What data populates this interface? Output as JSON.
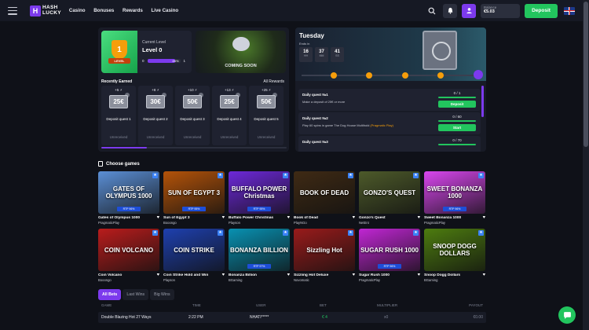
{
  "header": {
    "logo_mark": "H",
    "logo_line1": "HASH",
    "logo_line2": "LUCKY",
    "nav": [
      "Casino",
      "Bonuses",
      "Rewards",
      "Live Casino"
    ],
    "balance_label": "Balance",
    "balance_value": "€5.03",
    "deposit_label": "Deposit",
    "icons": [
      "menu-icon",
      "search-icon",
      "bell-icon",
      "user-icon",
      "uk-flag-icon"
    ]
  },
  "level": {
    "current_label": "Current Level",
    "name": "Level 0",
    "badge_number": "1",
    "badge_tag": "LEVEL",
    "from": "0",
    "to": "1",
    "progress_text": "85%",
    "progress": 0.85
  },
  "coming_soon": "COMING SOON",
  "rewards": {
    "recent_label": "Recently Earned",
    "all_label": "All Rewards",
    "items": [
      {
        "plus": "+5 ⚡",
        "amount": "25€",
        "name": "Deposit quest 1",
        "status": "Unreceived"
      },
      {
        "plus": "+8 ⚡",
        "amount": "30€",
        "name": "Deposit quest 2",
        "status": "Unreceived"
      },
      {
        "plus": "+10 ⚡",
        "amount": "50€",
        "name": "Deposit quest 3",
        "status": "Unreceived"
      },
      {
        "plus": "+13 ⚡",
        "amount": "25€",
        "name": "Deposit quest 4",
        "status": "Unreceived"
      },
      {
        "plus": "+25 ⚡",
        "amount": "50€",
        "name": "Deposit quest 5",
        "status": "Unreceived"
      }
    ]
  },
  "daily": {
    "day": "Tuesday",
    "ends_in": "Ends in",
    "timer": [
      {
        "n": "16",
        "u": "HH"
      },
      {
        "n": "37",
        "u": "MM"
      },
      {
        "n": "41",
        "u": "SS"
      }
    ],
    "quests": [
      {
        "title": "Daily quest №1",
        "desc": "Make a deposit of 25€ or more",
        "desc_highlight": "",
        "progress": "0 / 1",
        "button": "Deposit"
      },
      {
        "title": "Daily quest №2",
        "desc": "Play 60 spins in game The Dog House Multihold ",
        "desc_highlight": "(Pragmatic Play)",
        "progress": "0 / 60",
        "button": "Start"
      },
      {
        "title": "Daily quest №3",
        "desc": "",
        "desc_highlight": "",
        "progress": "0 / 70",
        "button": ""
      }
    ]
  },
  "games": {
    "title": "Choose games",
    "items": [
      {
        "name": "Gates of Olympus 1000",
        "provider": "PragmaticPlay",
        "art": "GATES OF OLYMPUS 1000",
        "bg": "#5b8fd6",
        "rtp": "RTP 96%"
      },
      {
        "name": "Sun of Egypt 3",
        "provider": "Booongo",
        "art": "SUN OF EGYPT 3",
        "bg": "#b45309",
        "rtp": "RTP 95%"
      },
      {
        "name": "Buffalo Power Christmas",
        "provider": "Playson",
        "art": "BUFFALO POWER Christmas",
        "bg": "#6d28d9",
        "rtp": "RTP 95%"
      },
      {
        "name": "Book of Dead",
        "provider": "PlayNGo",
        "art": "BOOK OF DEAD",
        "bg": "#3f2a14",
        "rtp": ""
      },
      {
        "name": "Gonzo's Quest",
        "provider": "NetEnt",
        "art": "GONZO'S QUEST",
        "bg": "#4d5a2a",
        "rtp": ""
      },
      {
        "name": "Sweet Bonanza 1000",
        "provider": "PragmaticPlay",
        "art": "SWEET BONANZA 1000",
        "bg": "#d946ef",
        "rtp": "RTP 96%"
      },
      {
        "name": "Coin Volcano",
        "provider": "Booongo",
        "art": "COIN VOLCANO",
        "bg": "#b91c1c",
        "rtp": ""
      },
      {
        "name": "Coin Strike Hold and Win",
        "provider": "Playson",
        "art": "COIN STRIKE",
        "bg": "#1e40af",
        "rtp": ""
      },
      {
        "name": "Bonanza Billion",
        "provider": "BGaming",
        "art": "BONANZA BILLION",
        "bg": "#0891b2",
        "rtp": "RTP 97%"
      },
      {
        "name": "Sizzling Hot Deluxe",
        "provider": "Novomatic",
        "art": "Sizzling Hot",
        "bg": "#991b1b",
        "rtp": ""
      },
      {
        "name": "Sugar Rush 1000",
        "provider": "PragmaticPlay",
        "art": "SUGAR RUSH 1000",
        "bg": "#c026d3",
        "rtp": "RTP 96%"
      },
      {
        "name": "Snoop Dogg Dollars",
        "provider": "BGaming",
        "art": "SNOOP DOGG DOLLARS",
        "bg": "#4d7c0f",
        "rtp": ""
      }
    ]
  },
  "bets": {
    "tabs": [
      "All Bets",
      "Last Wins",
      "Big Wins"
    ],
    "columns": [
      "GAME",
      "TIME",
      "USER",
      "BET",
      "MULTIPLIER",
      "PAYOUT"
    ],
    "rows": [
      {
        "game": "Double Blazing Hot 27 Ways",
        "time": "2:22 PM",
        "user": "NHATI*****",
        "bet": "€ 4",
        "multiplier": "x0",
        "payout": "€0.00"
      }
    ]
  },
  "colors": {
    "accent": "#7c3aed",
    "green": "#22c55e",
    "bg": "#0f1118",
    "panel": "#181b26"
  }
}
